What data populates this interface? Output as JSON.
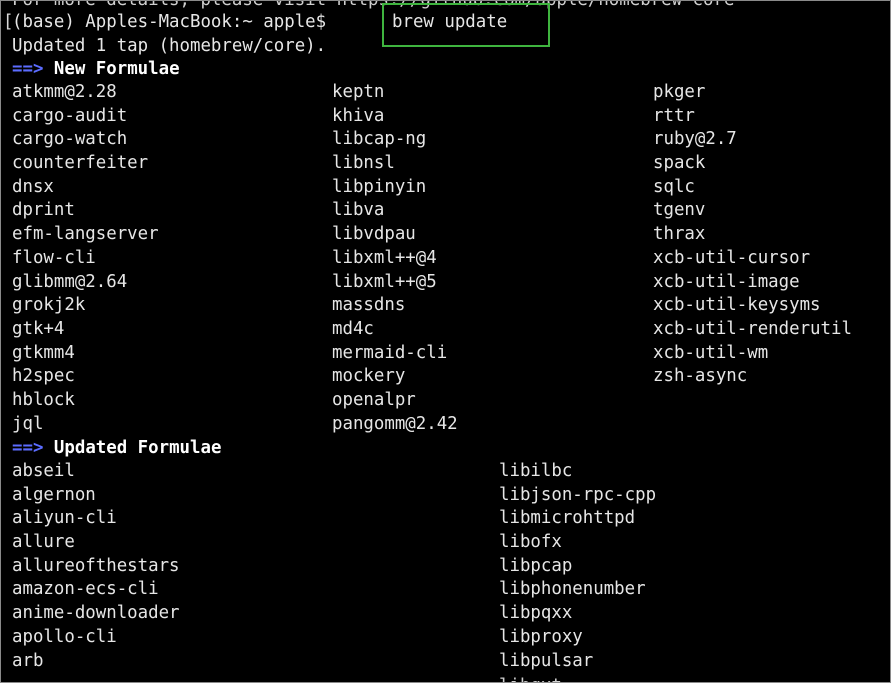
{
  "terminal": {
    "cut_top_text": "For more details, please visit https://github.com/apple/homebrew-core",
    "prompt": "(base) Apples-MacBook:~ apple$ ",
    "command": "brew update",
    "tap_message": "Updated 1 tap (homebrew/core).",
    "arrow": "==>",
    "new_formulae_title": "New Formulae",
    "updated_formulae_title": "Updated Formulae",
    "bottom_cut_text": "libqxt"
  },
  "new_formulae": {
    "col1": [
      "atkmm@2.28",
      "cargo-audit",
      "cargo-watch",
      "counterfeiter",
      "dnsx",
      "dprint",
      "efm-langserver",
      "flow-cli",
      "glibmm@2.64",
      "grokj2k",
      "gtk+4",
      "gtkmm4",
      "h2spec",
      "hblock",
      "jql"
    ],
    "col2": [
      "keptn",
      "khiva",
      "libcap-ng",
      "libnsl",
      "libpinyin",
      "libva",
      "libvdpau",
      "libxml++@4",
      "libxml++@5",
      "massdns",
      "md4c",
      "mermaid-cli",
      "mockery",
      "openalpr",
      "pangomm@2.42"
    ],
    "col3": [
      "pkger",
      "rttr",
      "ruby@2.7",
      "spack",
      "sqlc",
      "tgenv",
      "thrax",
      "xcb-util-cursor",
      "xcb-util-image",
      "xcb-util-keysyms",
      "xcb-util-renderutil",
      "xcb-util-wm",
      "zsh-async"
    ]
  },
  "updated_formulae": {
    "col1": [
      "abseil",
      "algernon",
      "aliyun-cli",
      "allure",
      "allureofthestars",
      "amazon-ecs-cli",
      "anime-downloader",
      "apollo-cli",
      "arb"
    ],
    "col2": [
      "libilbc",
      "libjson-rpc-cpp",
      "libmicrohttpd",
      "libofx",
      "libpcap",
      "libphonenumber",
      "libpqxx",
      "libproxy",
      "libpulsar"
    ]
  },
  "colors": {
    "background": "#000000",
    "text": "#e6e6e6",
    "arrow": "#5b6cff",
    "highlight_box": "#3fb43f"
  }
}
